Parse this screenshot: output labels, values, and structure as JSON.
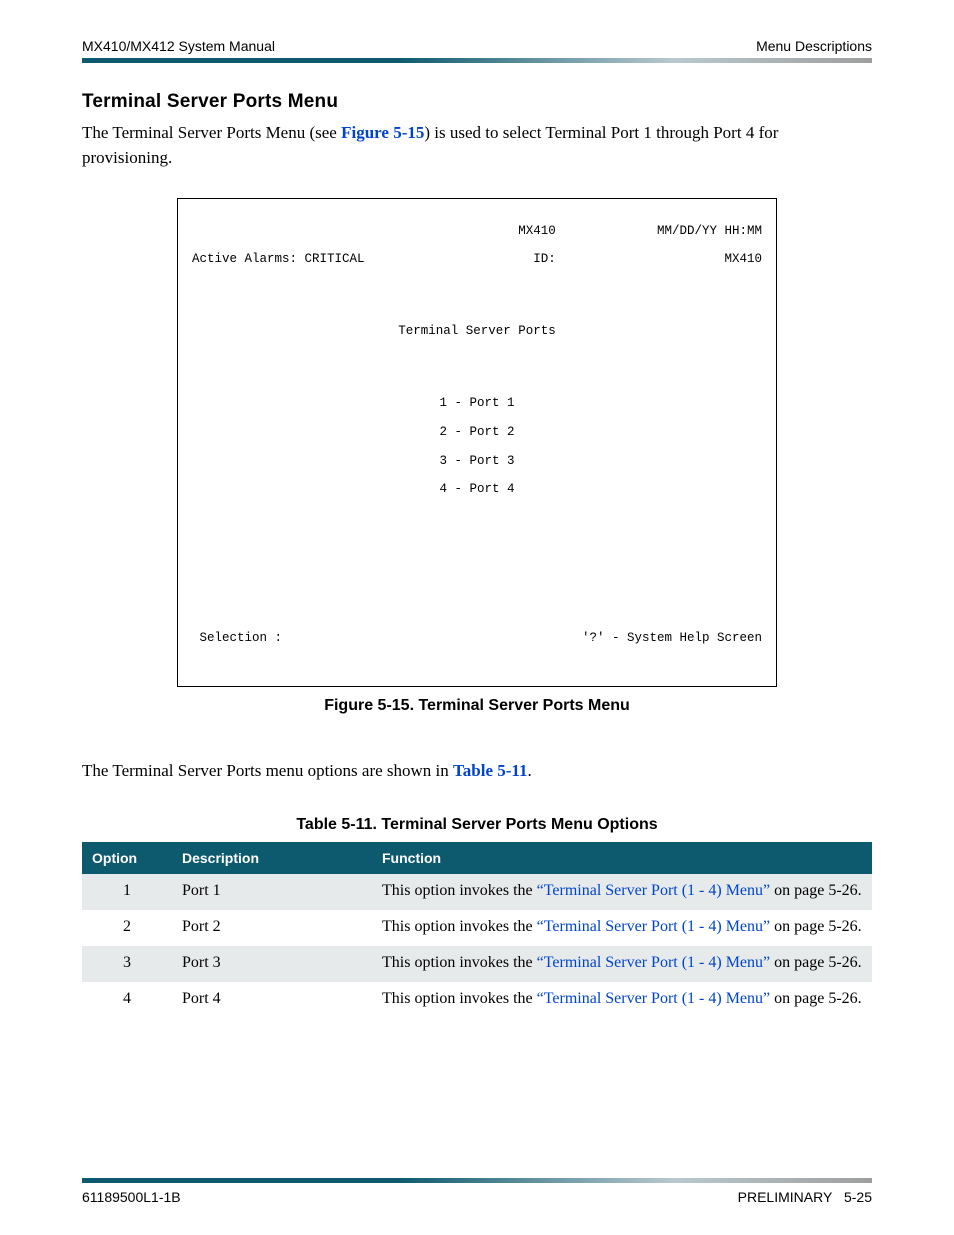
{
  "header": {
    "left": "MX410/MX412 System Manual",
    "right": "Menu Descriptions"
  },
  "section": {
    "title": "Terminal Server Ports Menu",
    "intro_pre": "The Terminal Server Ports Menu (see ",
    "intro_link": "Figure 5-15",
    "intro_post": ") is used to select Terminal Port 1 through Port 4 for provisioning."
  },
  "terminal": {
    "top_center": "MX410",
    "top_right": "MM/DD/YY HH:MM",
    "row2_left": "Active Alarms: CRITICAL",
    "row2_id": "ID:",
    "row2_right": "MX410",
    "title": "Terminal Server Ports",
    "items": [
      "1 - Port 1",
      "2 - Port 2",
      "3 - Port 3",
      "4 - Port 4"
    ],
    "sel_left": " Selection :",
    "sel_right": "'?' - System Help Screen"
  },
  "figure_caption": "Figure 5-15.  Terminal Server Ports Menu",
  "para2_pre": "The Terminal Server Ports menu options are shown in ",
  "para2_link": "Table 5-11",
  "para2_post": ".",
  "table_caption": "Table 5-11.  Terminal Server Ports Menu Options",
  "table": {
    "headers": [
      "Option",
      "Description",
      "Function"
    ],
    "rows": [
      {
        "option": "1",
        "desc": "Port 1",
        "func_pre": "This option invokes the ",
        "func_link": "“Terminal Server Port (1 - 4) Menu”",
        "func_post": " on page 5-26."
      },
      {
        "option": "2",
        "desc": "Port 2",
        "func_pre": "This option invokes the ",
        "func_link": "“Terminal Server Port (1 - 4) Menu”",
        "func_post": " on page 5-26."
      },
      {
        "option": "3",
        "desc": "Port 3",
        "func_pre": "This option invokes the ",
        "func_link": "“Terminal Server Port (1 - 4) Menu”",
        "func_post": " on page 5-26."
      },
      {
        "option": "4",
        "desc": "Port 4",
        "func_pre": "This option invokes the ",
        "func_link": "“Terminal Server Port (1 - 4) Menu”",
        "func_post": " on page 5-26."
      }
    ]
  },
  "footer": {
    "left": "61189500L1-1B",
    "right_label": "PRELIMINARY",
    "right_page": "5-25"
  }
}
